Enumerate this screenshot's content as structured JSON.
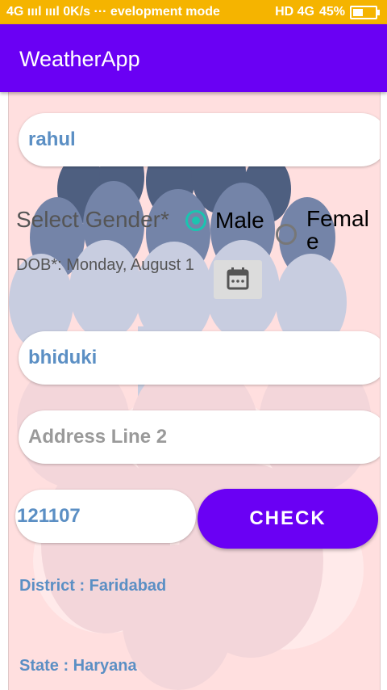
{
  "status_bar": {
    "left_text": "4G ıııl ıııl 0K/s ··· evelopment mode",
    "network": "HD 4G",
    "battery": "45%",
    "battery_level": 0.45
  },
  "app": {
    "title": "WeatherApp"
  },
  "form": {
    "name_value": "rahul",
    "gender_label": "Select Gender*",
    "gender_options": [
      "Male",
      "Femal e"
    ],
    "dob_text": "DOB*: Monday, August 1",
    "address1_value": "bhiduki",
    "address2_placeholder": "Address Line 2",
    "pincode_value": "121107",
    "check_label": "CHECK",
    "district_text": "District : Faridabad",
    "state_text": "State : Haryana"
  },
  "colors": {
    "accent": "#6a00f4",
    "status_bar": "#f5b400",
    "content_bg": "#ffdfdf",
    "radio_on": "#1bc4b0",
    "value_text": "#5b8fc4"
  },
  "icons": {
    "calendar": "calendar-icon",
    "battery": "battery-icon"
  }
}
